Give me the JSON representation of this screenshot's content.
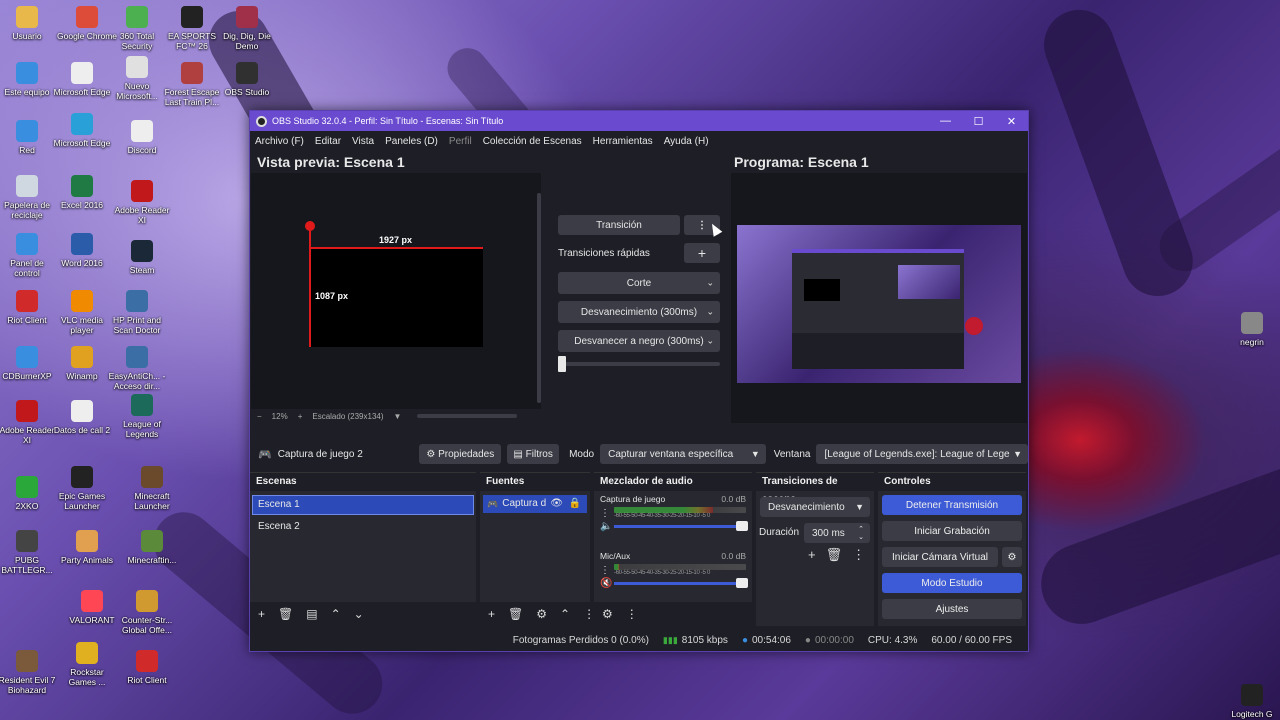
{
  "desktop": {
    "icons": [
      {
        "label": "Usuario",
        "icon": "folder-user-icon",
        "color": "#e8b84a"
      },
      {
        "label": "Google Chrome",
        "icon": "chrome-icon",
        "color": "#dd4b39"
      },
      {
        "label": "360 Total Security",
        "icon": "shield-icon",
        "color": "#4caf50"
      },
      {
        "label": "EA SPORTS FC™ 26",
        "icon": "ea-icon",
        "color": "#222222"
      },
      {
        "label": "Dig, Dig, Die Demo",
        "icon": "game-icon",
        "color": "#a0304a"
      },
      {
        "label": "Este equipo",
        "icon": "computer-icon",
        "color": "#3a8ee0"
      },
      {
        "label": "Microsoft Edge",
        "icon": "document-icon",
        "color": "#eeeeee"
      },
      {
        "label": "Nuevo Microsoft...",
        "icon": "pdf-icon",
        "color": "#e0e0e0"
      },
      {
        "label": "Forest Escape Last Train Pl...",
        "icon": "game-icon",
        "color": "#b04040"
      },
      {
        "label": "OBS Studio",
        "icon": "obs-icon",
        "color": "#303030"
      },
      {
        "label": "Red",
        "icon": "network-icon",
        "color": "#3a8ee0"
      },
      {
        "label": "Microsoft Edge",
        "icon": "edge-icon",
        "color": "#2aa0d8"
      },
      {
        "label": "Discord",
        "icon": "document-icon",
        "color": "#eeeeee"
      },
      {
        "label": "Papelera de reciclaje",
        "icon": "recycle-bin-icon",
        "color": "#cfd8e0"
      },
      {
        "label": "Excel 2016",
        "icon": "excel-icon",
        "color": "#1f7a44"
      },
      {
        "label": "Adobe Reader XI",
        "icon": "pdf-icon",
        "color": "#c0181b"
      },
      {
        "label": "Panel de control",
        "icon": "control-panel-icon",
        "color": "#3a8ee0"
      },
      {
        "label": "Word 2016",
        "icon": "word-icon",
        "color": "#2b5caa"
      },
      {
        "label": "Steam",
        "icon": "steam-icon",
        "color": "#1b2838"
      },
      {
        "label": "Riot Client",
        "icon": "riot-icon",
        "color": "#d12a2a"
      },
      {
        "label": "VLC media player",
        "icon": "vlc-icon",
        "color": "#f08a00"
      },
      {
        "label": "HP Print and Scan Doctor",
        "icon": "printer-icon",
        "color": "#3a6ea5"
      },
      {
        "label": "CDBurnerXP",
        "icon": "disc-icon",
        "color": "#3a8ee0"
      },
      {
        "label": "Winamp",
        "icon": "winamp-icon",
        "color": "#e0a020"
      },
      {
        "label": "EasyAntiCh... - Acceso dir...",
        "icon": "shield-icon",
        "color": "#3a6ea5"
      },
      {
        "label": "Adobe Reader XI",
        "icon": "pdf-icon",
        "color": "#c0181b"
      },
      {
        "label": "Datos de call 2",
        "icon": "document-icon",
        "color": "#eeeeee"
      },
      {
        "label": "League of Legends",
        "icon": "lol-icon",
        "color": "#1b6a5a"
      },
      {
        "label": "2XKO",
        "icon": "game-icon",
        "color": "#2aa83a"
      },
      {
        "label": "Epic Games Launcher",
        "icon": "epic-icon",
        "color": "#222222"
      },
      {
        "label": "Minecraft Launcher",
        "icon": "minecraft-icon",
        "color": "#6a4a2a"
      },
      {
        "label": "PUBG BATTLEGR...",
        "icon": "pubg-icon",
        "color": "#444444"
      },
      {
        "label": "Party Animals",
        "icon": "game-icon",
        "color": "#e0a050"
      },
      {
        "label": "Minecraftin...",
        "icon": "minecraft-icon",
        "color": "#5a8a3a"
      },
      {
        "label": "VALORANT",
        "icon": "valorant-icon",
        "color": "#ff4655"
      },
      {
        "label": "Counter-Str... Global Offe...",
        "icon": "csgo-icon",
        "color": "#d09a30"
      },
      {
        "label": "Resident Evil 7 Biohazard",
        "icon": "game-icon",
        "color": "#7a5a3a"
      },
      {
        "label": "Rockstar Games ...",
        "icon": "rockstar-icon",
        "color": "#e0b020"
      },
      {
        "label": "Riot Client",
        "icon": "riot-icon",
        "color": "#d12a2a"
      },
      {
        "label": "negrin",
        "icon": "file-icon",
        "color": "#888888"
      },
      {
        "label": "Logitech G HUB",
        "icon": "logitech-icon",
        "color": "#222222"
      }
    ]
  },
  "obs": {
    "title": "OBS Studio 32.0.4 - Perfil: Sin Título - Escenas: Sin Título",
    "menu": [
      "Archivo (F)",
      "Editar",
      "Vista",
      "Paneles (D)",
      "Perfil",
      "Colección de Escenas",
      "Herramientas",
      "Ayuda (H)"
    ],
    "preview_title": "Vista previa: Escena 1",
    "program_title": "Programa: Escena 1",
    "preview_width": "1927 px",
    "preview_height": "1087 px",
    "zoom": "12%",
    "scale_label": "Escalado (239x134)",
    "transition_label": "Transición",
    "quick_transitions": "Transiciones rápidas",
    "quick_items": [
      "Corte",
      "Desvanecimiento (300ms)",
      "Desvanecer a negro (300ms)"
    ],
    "source_name": "Captura de juego 2",
    "properties": "Propiedades",
    "filters": "Filtros",
    "mode_label": "Modo",
    "mode_value": "Capturar ventana específica",
    "window_label": "Ventana",
    "window_value": "[League of Legends.exe]: League of Legenc",
    "scenes_title": "Escenas",
    "scenes": [
      "Escena 1",
      "Escena 2"
    ],
    "sources_title": "Fuentes",
    "sources": [
      "Captura d"
    ],
    "mixer_title": "Mezclador de audio",
    "mixer": [
      {
        "name": "Captura de juego",
        "db": "0.0 dB",
        "level": 0.75
      },
      {
        "name": "Mic/Aux",
        "db": "0.0 dB",
        "level": 0.04
      }
    ],
    "mixer_ticks": "-60-55-50-45-40-35-30-25-20-15-10 -5  0",
    "transitions_title": "Transiciones de escena",
    "transition_value": "Desvanecimiento",
    "duration_label": "Duración",
    "duration_value": "300 ms",
    "controls_title": "Controles",
    "controls": {
      "stop_stream": "Detener Transmisión",
      "start_record": "Iniciar Grabación",
      "virtual_cam": "Iniciar Cámara Virtual",
      "studio_mode": "Modo Estudio",
      "settings": "Ajustes"
    },
    "status": {
      "dropped": "Fotogramas Perdidos 0 (0.0%)",
      "bitrate": "8105 kbps",
      "stream_time": "00:54:06",
      "record_time": "00:00:00",
      "cpu": "CPU: 4.3%",
      "fps": "60.00 / 60.00 FPS"
    }
  }
}
